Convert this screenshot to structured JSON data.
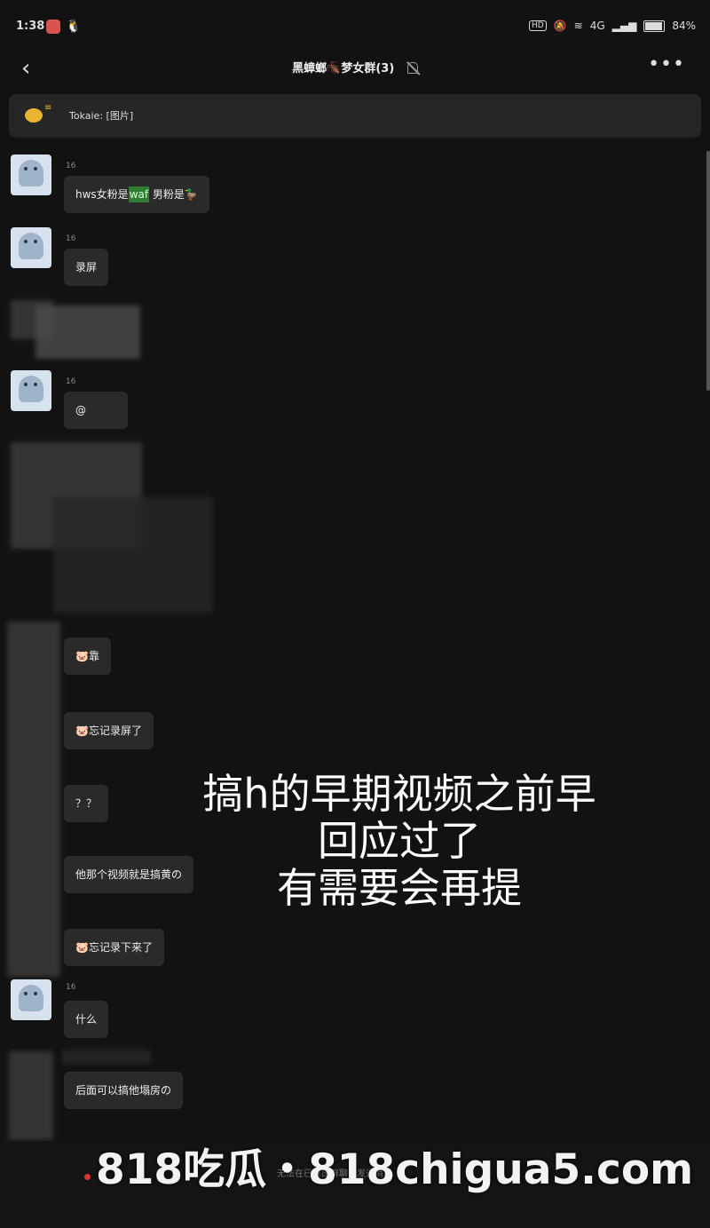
{
  "status_bar": {
    "time": "1:38",
    "network": "4G",
    "battery": "84%",
    "battery_level": 0.84
  },
  "header": {
    "title": "黑蟑螂🪳梦女群(3)",
    "back_icon": "chevron-left-icon",
    "more_icon": "more-dots-icon"
  },
  "notice": {
    "text": "Tokaie: [图片]"
  },
  "messages": [
    {
      "nick": "16",
      "text_pre": "hws女粉是",
      "highlight": "waf",
      "text_post": " 男粉是🦆"
    },
    {
      "nick": "16",
      "text": "录屏"
    },
    {
      "nick": "16",
      "text": "@"
    },
    {
      "text": "🐷靠"
    },
    {
      "text": "🐷忘记录屏了"
    },
    {
      "text": "？？"
    },
    {
      "text": "他那个视频就是搞黄の"
    },
    {
      "text": "🐷忘记录下来了"
    },
    {
      "nick": "16",
      "text": "什么"
    },
    {
      "text": "后面可以搞他塌房の"
    }
  ],
  "caption": {
    "line1": "搞h的早期视频之前早",
    "line2": "回应过了",
    "line3": "有需要会再提"
  },
  "bottom": {
    "hint": "无法在已退出群聊中发送消息"
  },
  "watermark": {
    "text": "818吃瓜・818chigua5.com"
  }
}
